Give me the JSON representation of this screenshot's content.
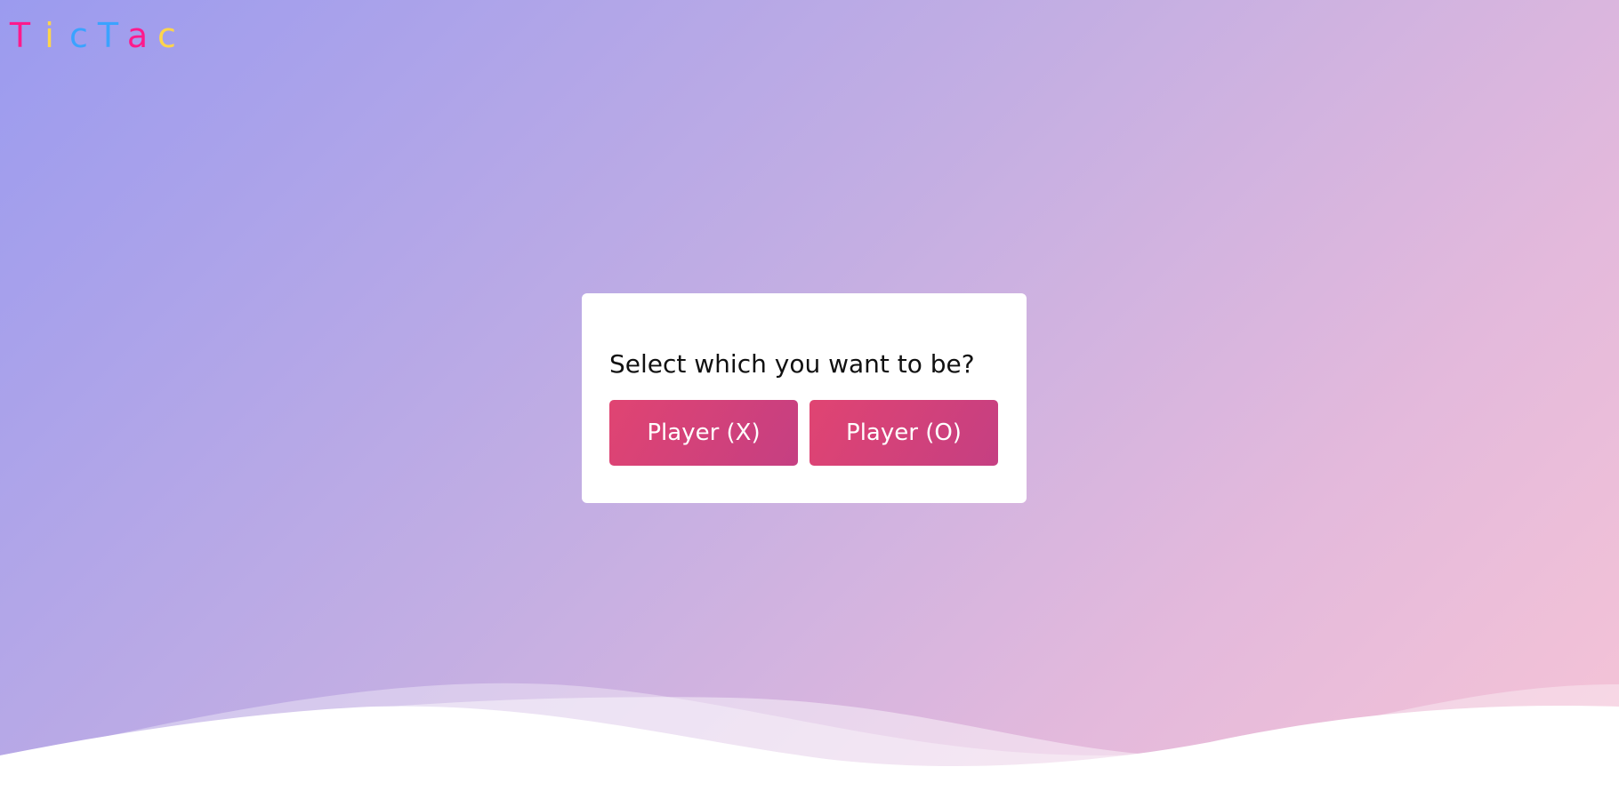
{
  "logo": {
    "letters": [
      {
        "char": "T",
        "color": "#ff1a8c"
      },
      {
        "char": "i",
        "color": "#ffd54a"
      },
      {
        "char": "c",
        "color": "#3aa3ff"
      },
      {
        "char": "T",
        "color": "#3aa3ff"
      },
      {
        "char": "a",
        "color": "#ff1a8c"
      },
      {
        "char": "c",
        "color": "#ffd54a"
      }
    ]
  },
  "select_box": {
    "title": "Select which you want to be?",
    "player_x_label": "Player (X)",
    "player_o_label": "Player (O)"
  },
  "colors": {
    "background_start": "#9b9bef",
    "background_end": "#f6c4d6",
    "button_start": "#e04472",
    "button_end": "#c53f82",
    "card": "#ffffff"
  }
}
